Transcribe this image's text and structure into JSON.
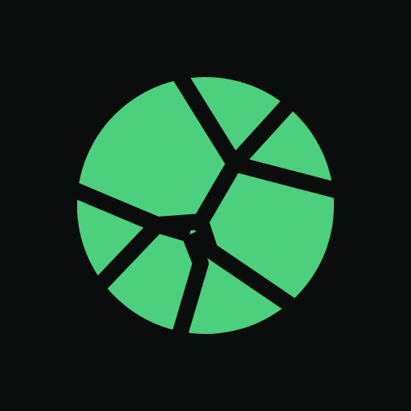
{
  "app_icon": {
    "icon_name": "cracked-globe-logo-icon",
    "colors": {
      "background": "#0b0d0c",
      "accent": "#4cd07d",
      "divider": "#0b0d0c"
    }
  }
}
